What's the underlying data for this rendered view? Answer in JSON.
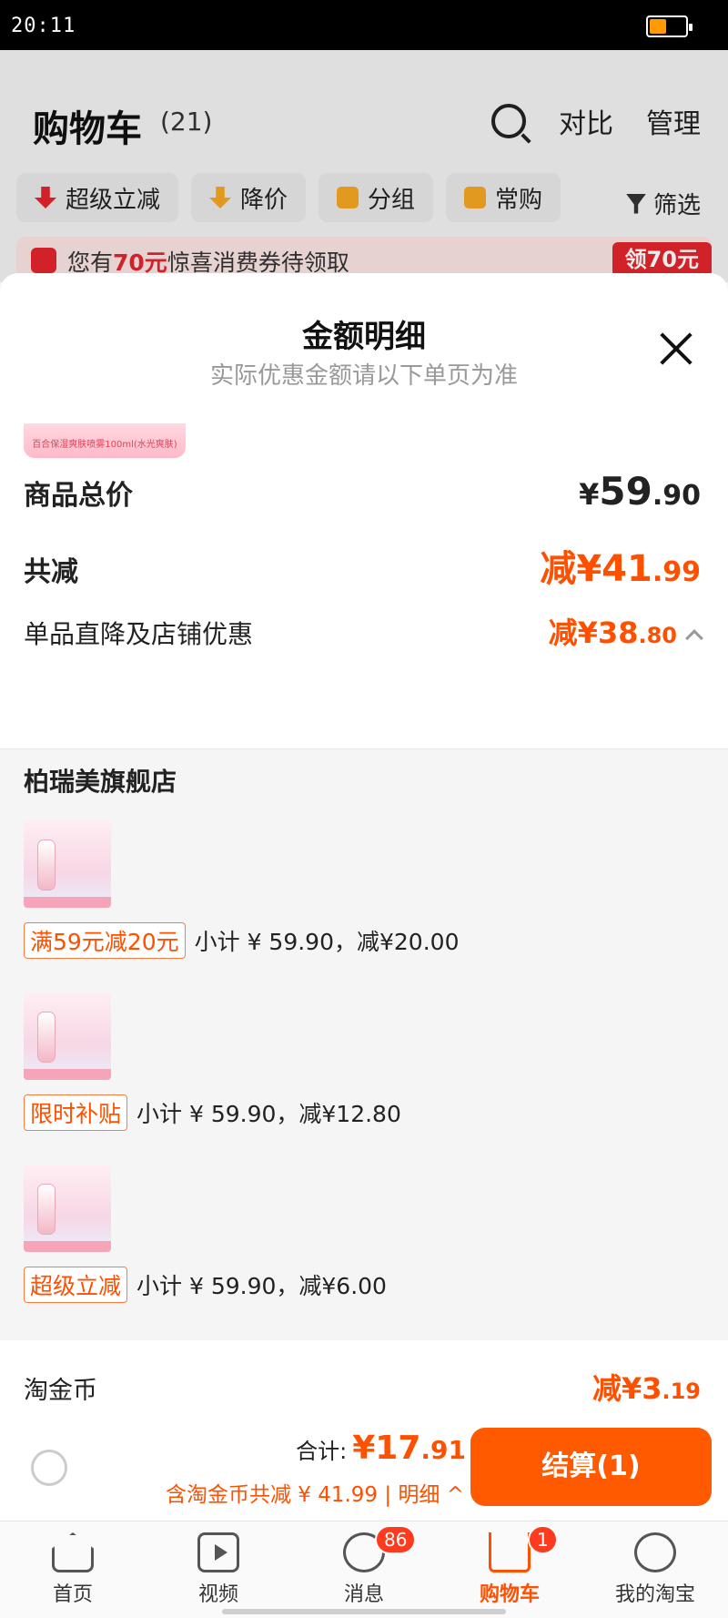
{
  "status_bar": {
    "time": "20:11"
  },
  "cart": {
    "title": "购物车",
    "count": "(21)",
    "actions": {
      "compare": "对比",
      "manage": "管理"
    },
    "filter_chips": [
      {
        "label": "超级立减"
      },
      {
        "label": "降价"
      },
      {
        "label": "分组"
      },
      {
        "label": "常购"
      }
    ],
    "filter_label": "筛选",
    "coupon_banner": {
      "prefix": "您有",
      "amount": "70元",
      "suffix": "惊喜消费券待领取",
      "button": "领70元"
    }
  },
  "sheet": {
    "title": "金额明细",
    "subtitle": "实际优惠金额请以下单页为准",
    "partial_thumb_text": "百合保湿爽肤喷雾100ml(水光爽肤)",
    "total_label": "商品总价",
    "total_currency": "¥",
    "total_int": "59",
    "total_dec": ".90",
    "reduce_label": "共减",
    "reduce_value_int": "减¥41",
    "reduce_value_dec": ".99",
    "discount_label": "单品直降及店铺优惠",
    "discount_value_int": "减¥38",
    "discount_value_dec": ".80",
    "shop_name": "柏瑞美旗舰店",
    "items": [
      {
        "tag": "满59元减20元",
        "subtotal": "小计 ¥ 59.90，减¥20.00"
      },
      {
        "tag": "限时补贴",
        "subtotal": "小计 ¥ 59.90，减¥12.80"
      },
      {
        "tag": "超级立减",
        "subtotal": "小计 ¥ 59.90，减¥6.00"
      }
    ],
    "coins_label": "淘金币",
    "coins_value_int": "减¥3",
    "coins_value_dec": ".19"
  },
  "checkout": {
    "total_label": "合计:",
    "total_int": "¥17",
    "total_dec": ".91",
    "saving_text": "含淘金币共减 ¥ 41.99 | 明细 ^",
    "pay_button": "结算(1)"
  },
  "tabbar": {
    "tabs": [
      {
        "label": "首页",
        "icon": "home-icon"
      },
      {
        "label": "视频",
        "icon": "video-icon"
      },
      {
        "label": "消息",
        "icon": "message-icon",
        "badge": "86"
      },
      {
        "label": "购物车",
        "icon": "cart-icon",
        "badge": "1",
        "active": true
      },
      {
        "label": "我的淘宝",
        "icon": "profile-icon"
      }
    ]
  },
  "colors": {
    "accent": "#ff5000",
    "pay_button": "#ff5a00",
    "coupon_red": "#e4252d"
  }
}
